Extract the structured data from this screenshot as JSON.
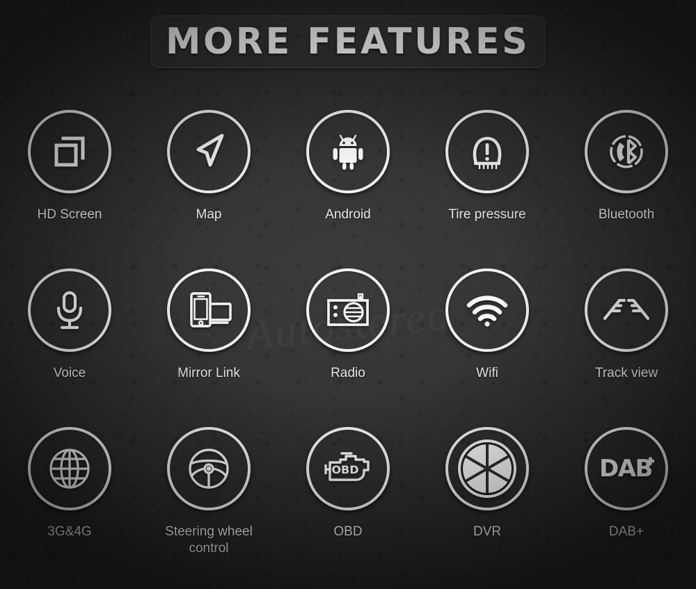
{
  "page": {
    "title": "MORE FEATURES",
    "watermark": "Autostereo",
    "background_color": "#2c2c2c",
    "accent_color": "#f2f2f2",
    "label_color": "#e8e8e8"
  },
  "features": [
    {
      "label": "HD Screen",
      "icon": "hd-screen-icon"
    },
    {
      "label": "Map",
      "icon": "navigation-arrow-icon"
    },
    {
      "label": "Android",
      "icon": "android-robot-icon"
    },
    {
      "label": "Tire pressure",
      "icon": "tire-pressure-icon"
    },
    {
      "label": "Bluetooth",
      "icon": "bluetooth-phone-icon"
    },
    {
      "label": "Voice",
      "icon": "microphone-icon"
    },
    {
      "label": "Mirror Link",
      "icon": "mirror-link-icon"
    },
    {
      "label": "Radio",
      "icon": "radio-icon"
    },
    {
      "label": "Wifi",
      "icon": "wifi-icon"
    },
    {
      "label": "Track view",
      "icon": "track-view-icon"
    },
    {
      "label": "3G&4G",
      "icon": "globe-icon"
    },
    {
      "label": "Steering wheel\ncontrol",
      "icon": "steering-wheel-icon"
    },
    {
      "label": "OBD",
      "icon": "obd-engine-icon"
    },
    {
      "label": "DVR",
      "icon": "aperture-icon"
    },
    {
      "label": "DAB+",
      "icon": "dab-plus-icon"
    }
  ]
}
